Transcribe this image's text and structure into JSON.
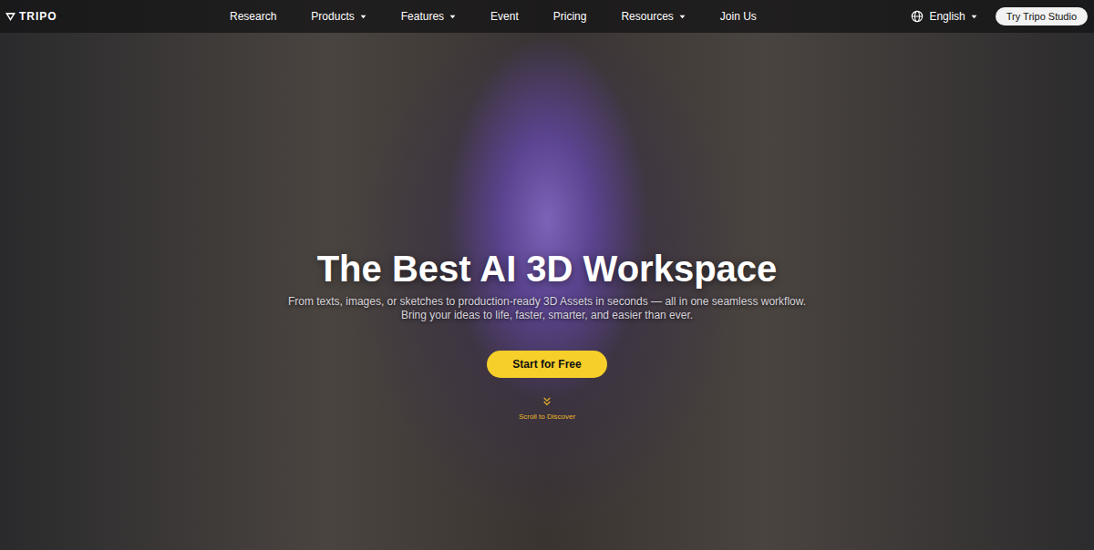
{
  "logo": {
    "text": "TRIPO"
  },
  "nav": {
    "items": [
      {
        "label": "Research",
        "dropdown": false
      },
      {
        "label": "Products",
        "dropdown": true
      },
      {
        "label": "Features",
        "dropdown": true
      },
      {
        "label": "Event",
        "dropdown": false
      },
      {
        "label": "Pricing",
        "dropdown": false
      },
      {
        "label": "Resources",
        "dropdown": true
      },
      {
        "label": "Join Us",
        "dropdown": false
      }
    ]
  },
  "language": {
    "label": "English",
    "dropdown": true
  },
  "cta": "Try Tripo Studio",
  "hero": {
    "title": "The Best AI 3D Workspace",
    "subtitle": [
      "From texts, images, or sketches to production-ready 3D Assets in seconds — all in one seamless workflow.",
      "Bring your ideas to life, faster, smarter, and easier than ever."
    ],
    "button": "Start for Free",
    "scroll": "Scroll to Discover"
  }
}
